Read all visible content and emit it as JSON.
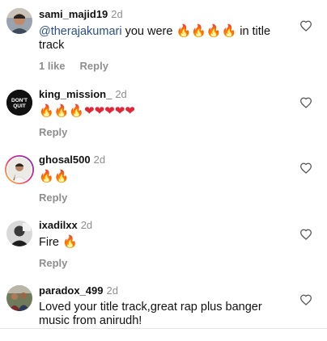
{
  "comments": [
    {
      "username": "sami_majid19",
      "time": "2d",
      "mention": "@therajakumari",
      "text_before": " you were ",
      "emojis": "🔥🔥🔥🔥",
      "text_after": " in title track",
      "likes": "1 like",
      "reply": "Reply",
      "avatar_icon": "person-photo-avatar"
    },
    {
      "username": "king_mission_",
      "time": "2d",
      "emojis_fire": "🔥🔥🔥",
      "emojis_heart": "❤❤❤❤❤",
      "reply": "Reply",
      "avatar_text": "DON'T QUIT",
      "avatar_icon": "dont-quit-logo-avatar"
    },
    {
      "username": "ghosal500",
      "time": "2d",
      "emojis": "🔥🔥",
      "reply": "Reply",
      "avatar_icon": "person-photo-avatar-with-story-ring"
    },
    {
      "username": "ixadilxx",
      "time": "2d",
      "text": "Fire ",
      "emojis": "🔥",
      "reply": "Reply",
      "avatar_icon": "person-photo-avatar"
    },
    {
      "username": "paradox_499",
      "time": "2d",
      "text": "Loved your title track,great rap plus banger music from anirudh!",
      "avatar_icon": "group-photo-avatar"
    }
  ],
  "icons": {
    "like": "heart-outline-icon"
  },
  "colors": {
    "username": "#111111",
    "secondary": "#8e8e8e",
    "mention": "#2a4f8a",
    "fire": "#f0701a",
    "heart": "#e32636",
    "story_ring_start": "#f9ce34",
    "story_ring_end": "#ee2a7b"
  }
}
